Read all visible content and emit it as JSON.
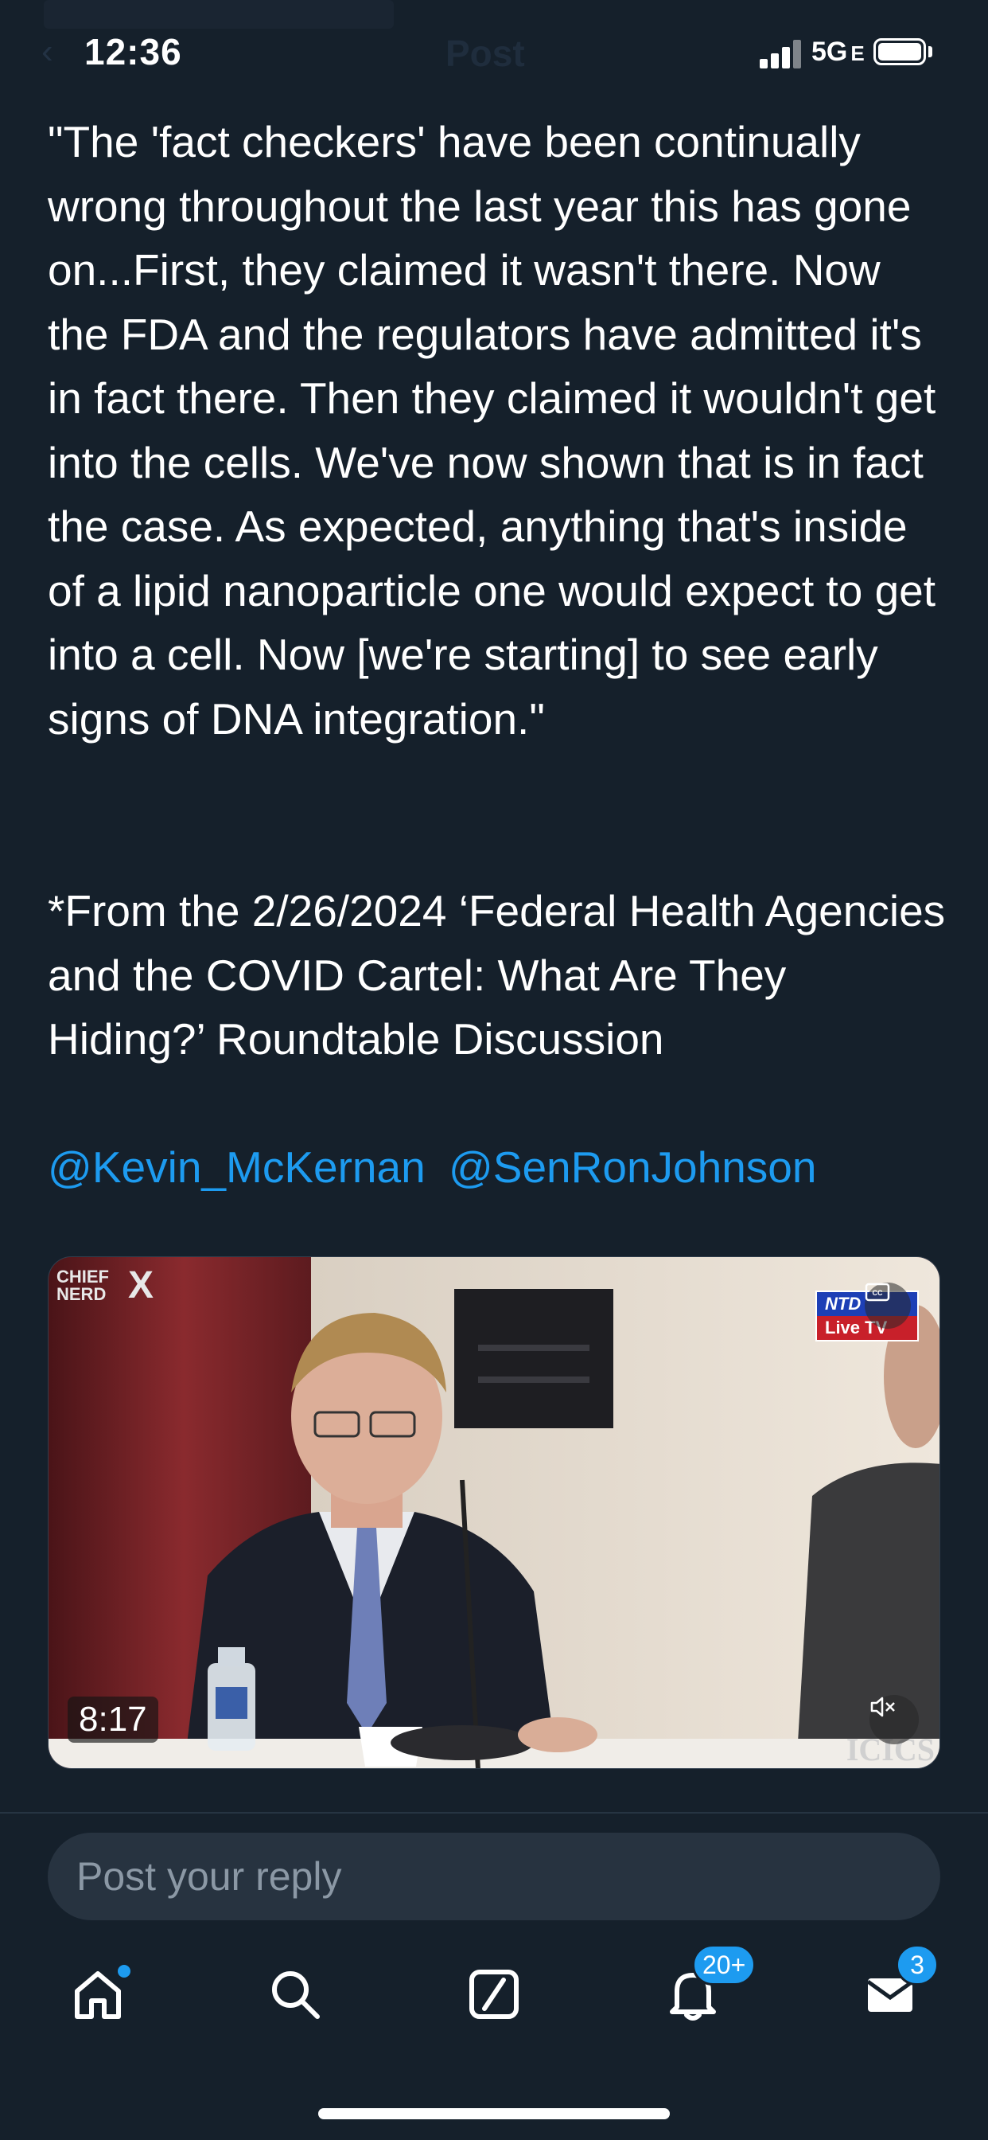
{
  "status_bar": {
    "time": "12:36",
    "network": "5G",
    "network_suffix": "E",
    "header_title": "Post"
  },
  "tweet": {
    "text": "\"The 'fact checkers' have been continually wrong throughout the last year this has gone on...First, they claimed it wasn't there. Now the FDA and the regulators have admitted it's in fact there. Then they claimed it wouldn't get into the cells. We've now shown that is in fact the case. As expected, anything that's inside of a lipid nanoparticle one would expect to get into a cell. Now [we're starting] to see early signs of DNA integration.\"",
    "source": "*From the 2/26/2024 ‘Federal Health Agencies and the COVID Cartel: What Are They Hiding?’ Roundtable Discussion",
    "mentions": [
      "@Kevin_McKernan",
      "@SenRonJohnson"
    ]
  },
  "video": {
    "watermark_line1": "CHIEF",
    "watermark_line2": "NERD",
    "watermark_mark": "X",
    "ntd_label": "NTD",
    "live_label": "Live TV",
    "duration": "8:17",
    "corner_text": "ICICS"
  },
  "reply": {
    "placeholder": "Post your reply"
  },
  "nav": {
    "notifications_badge": "20+",
    "messages_badge": "3"
  },
  "colors": {
    "background": "#15202b",
    "accent": "#1d9bf0",
    "reply_bg": "#273340"
  }
}
